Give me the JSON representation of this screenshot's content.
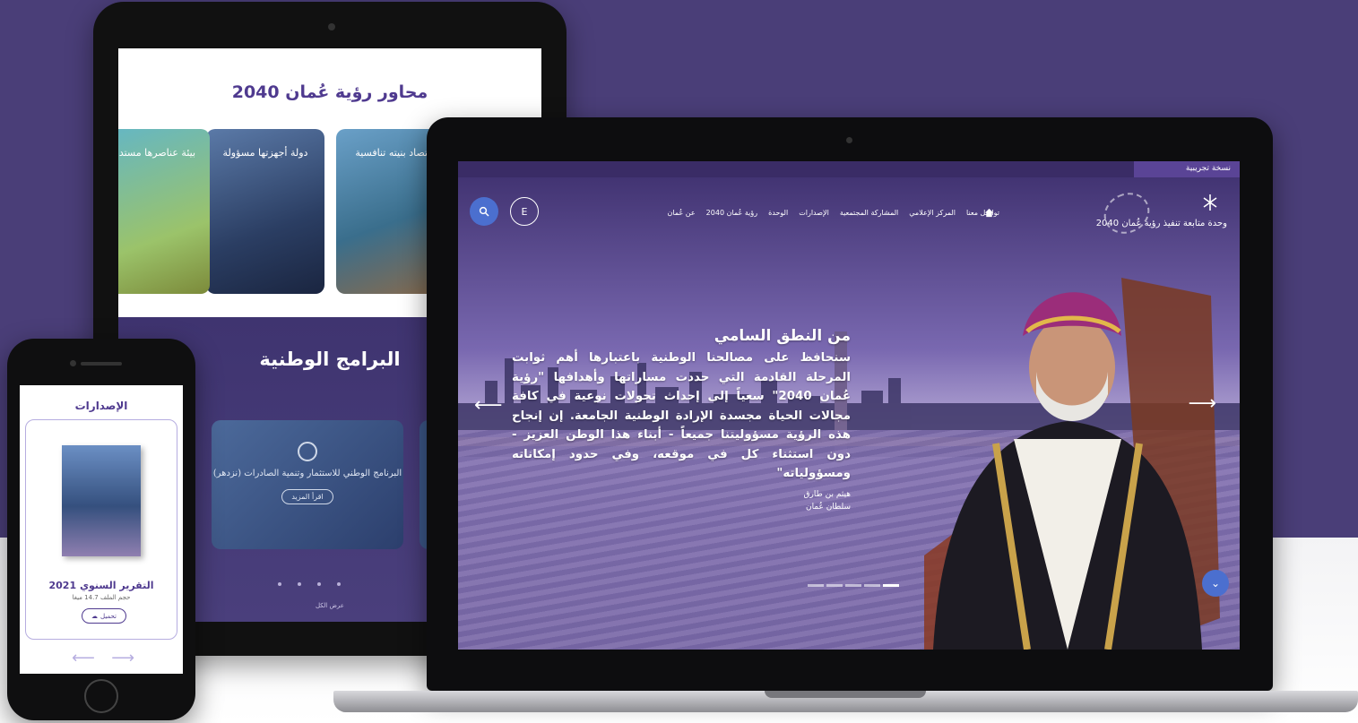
{
  "tablet": {
    "axes_title": "محاور رؤية عُمان 2040",
    "axes": [
      {
        "label": "اقتصاد بنيته تنافسية"
      },
      {
        "label": "دولة أجهزتها مسؤولة"
      },
      {
        "label": "بيئة عناصرها مستدامة"
      }
    ],
    "programs_title": "البرامج الوطنية",
    "program_card": {
      "label": "البرنامج الوطني للاستثمار وتنمية الصادرات (نزدهر)",
      "button": "اقرأ المزيد"
    },
    "view_all": "عرض الكل"
  },
  "laptop": {
    "beta_label": "نسخة تجريبية",
    "logo_text": "وحدة متابعة تنفيذ رؤية عُمان 2040",
    "nav": [
      "عن عُمان",
      "رؤية عُمان 2040",
      "الوحدة",
      "الإصدارات",
      "المشاركة المجتمعية",
      "المركز الإعلامي",
      "تواصل معنا"
    ],
    "lang_label": "E",
    "quote_heading": "من النطق السامي",
    "quote_text": "سنحافظ على مصالحنا الوطنية باعتبارها أهم ثوابت المرحلة القادمة التي حددت مساراتها وأهدافها \"رؤية عُمان 2040\" سعياً إلى إحداث تحولات نوعية في كافة مجالات الحياة مجسدة الإرادة الوطنية الجامعة. إن إنجاح هذه الرؤية مسؤوليتنا جميعاً - أبناء هذا الوطن العزيز - دون استثناء كل في موقعه، وفي حدود إمكاناته ومسؤولياته\"",
    "attribution_name": "هيثم بن طارق",
    "attribution_title": "سلطان عُمان",
    "icons": {
      "search": "search-icon",
      "home": "home-icon",
      "down": "chevron-down-icon"
    }
  },
  "phone": {
    "title": "الإصدارات",
    "report_title": "التقرير السنوي 2021",
    "file_size": "حجم الملف 14.7 ميغا",
    "download_label": "تحميل"
  },
  "colors": {
    "brand_purple": "#4a3e78",
    "accent_blue": "#4b6fcf",
    "title_purple": "#4f3a8f"
  }
}
